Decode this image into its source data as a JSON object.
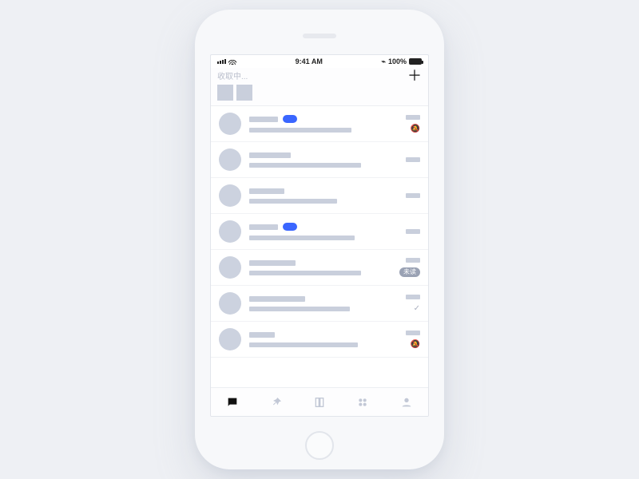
{
  "statusbar": {
    "time": "9:41 AM",
    "battery_pct": "100%"
  },
  "header": {
    "loading_text": "收取中..."
  },
  "rows": [
    {
      "title_w": 36,
      "line2_w": 128,
      "has_badge": true,
      "right": "mute"
    },
    {
      "title_w": 52,
      "line2_w": 140,
      "has_badge": false,
      "right": "none"
    },
    {
      "title_w": 44,
      "line2_w": 110,
      "has_badge": false,
      "right": "none"
    },
    {
      "title_w": 36,
      "line2_w": 132,
      "has_badge": true,
      "right": "none"
    },
    {
      "title_w": 58,
      "line2_w": 140,
      "has_badge": false,
      "right": "pill",
      "pill_text": "未读"
    },
    {
      "title_w": 70,
      "line2_w": 126,
      "has_badge": false,
      "right": "check"
    },
    {
      "title_w": 32,
      "line2_w": 136,
      "has_badge": false,
      "right": "mute"
    }
  ],
  "tabs": [
    {
      "name": "chat",
      "active": true
    },
    {
      "name": "pin",
      "active": false
    },
    {
      "name": "docs",
      "active": false
    },
    {
      "name": "apps",
      "active": false
    },
    {
      "name": "me",
      "active": false
    }
  ]
}
